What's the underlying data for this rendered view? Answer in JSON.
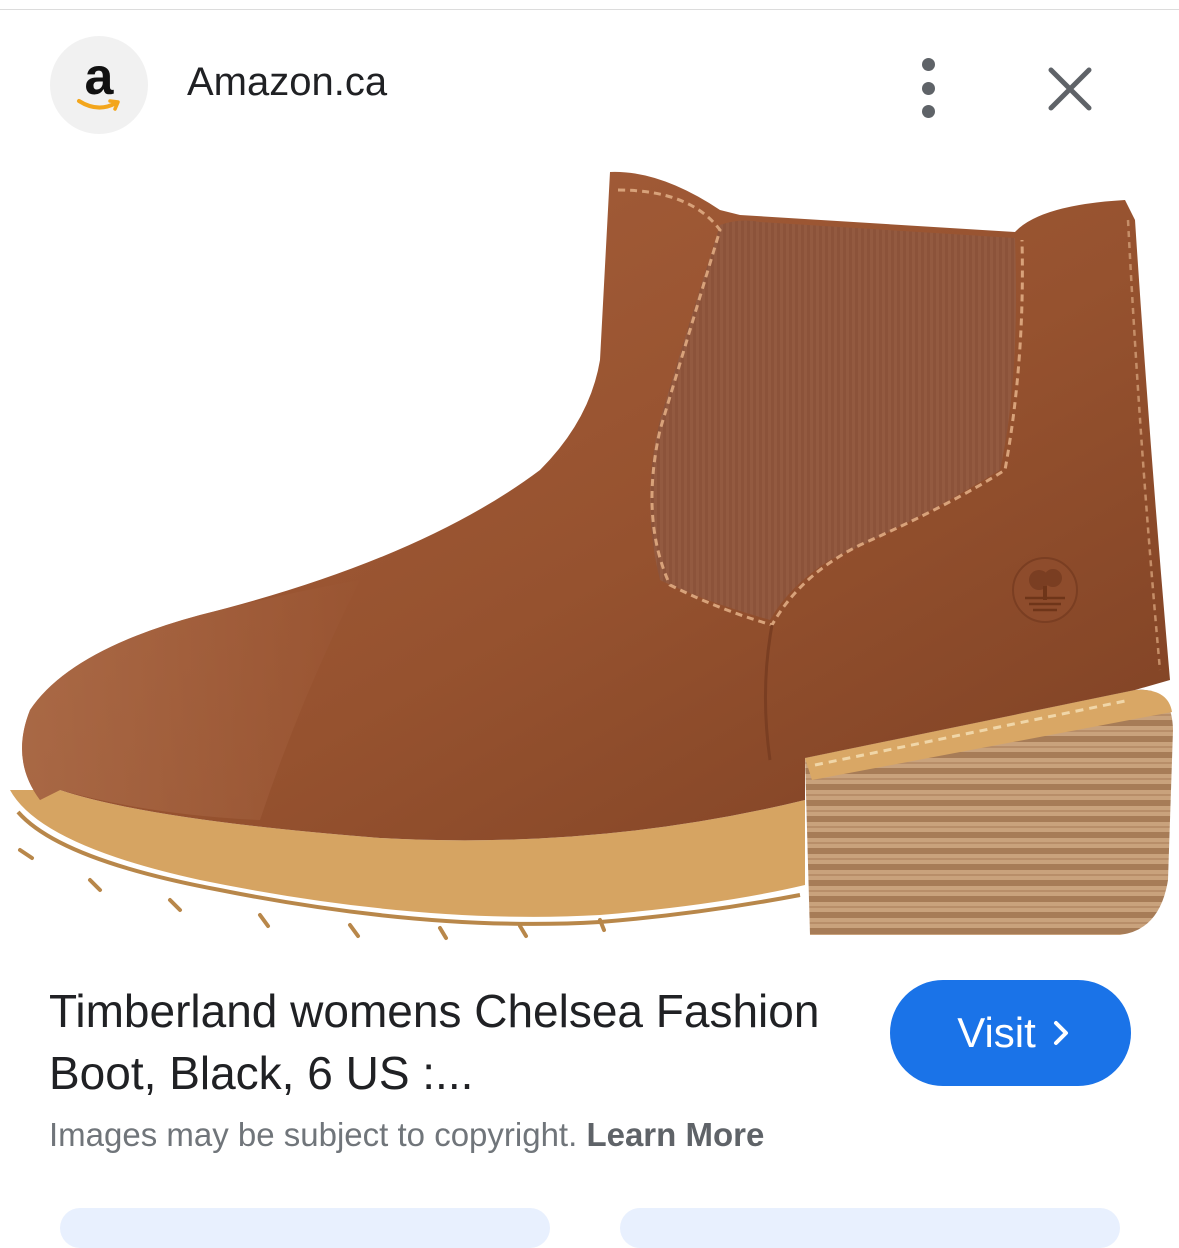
{
  "header": {
    "source_logo_letter": "a",
    "source_name": "Amazon.ca",
    "more_icon": "more-vert-icon",
    "close_icon": "close-icon"
  },
  "image": {
    "subject": "product-photo",
    "brand_logo": "timberland-tree-logo"
  },
  "result": {
    "title": "Timberland womens Chelsea Fashion Boot, Black, 6 US :...",
    "visit_label": "Visit",
    "visit_icon": "chevron-right-icon"
  },
  "footer": {
    "copyright_text": "Images may be subject to copyright.",
    "learn_more_label": "Learn More"
  },
  "colors": {
    "accent": "#1a73e8",
    "text_primary": "#202124",
    "text_secondary": "#70757a",
    "leather": "#9a5533",
    "sole": "#d9a765"
  }
}
